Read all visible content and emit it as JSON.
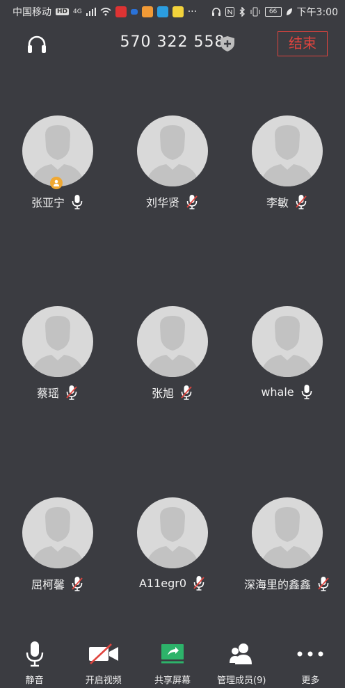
{
  "status_bar": {
    "carrier": "中国移动",
    "hd_badge": "HD",
    "network": "4G",
    "battery": "66",
    "time": "下午3:00",
    "more": "···"
  },
  "header": {
    "meeting_id": "570 322 558",
    "end_label": "结束"
  },
  "participants": [
    {
      "name": "张亚宁",
      "muted": false,
      "host": true
    },
    {
      "name": "刘华贤",
      "muted": true,
      "host": false
    },
    {
      "name": "李敏",
      "muted": true,
      "host": false
    },
    {
      "name": "蔡瑶",
      "muted": true,
      "host": false
    },
    {
      "name": "张旭",
      "muted": true,
      "host": false
    },
    {
      "name": "whale",
      "muted": false,
      "host": false
    },
    {
      "name": "屈柯馨",
      "muted": true,
      "host": false
    },
    {
      "name": "A11egr0",
      "muted": true,
      "host": false
    },
    {
      "name": "深海里的鑫鑫",
      "muted": true,
      "host": false
    }
  ],
  "toolbar": {
    "mute_label": "静音",
    "video_label": "开启视频",
    "share_label": "共享屏幕",
    "members_label": "管理成员(9)",
    "more_label": "更多"
  },
  "colors": {
    "background": "#3b3c41",
    "end_red": "#e0443e",
    "mute_red": "#e0443e",
    "share_green": "#2db36a",
    "host_badge": "#f0a832"
  }
}
